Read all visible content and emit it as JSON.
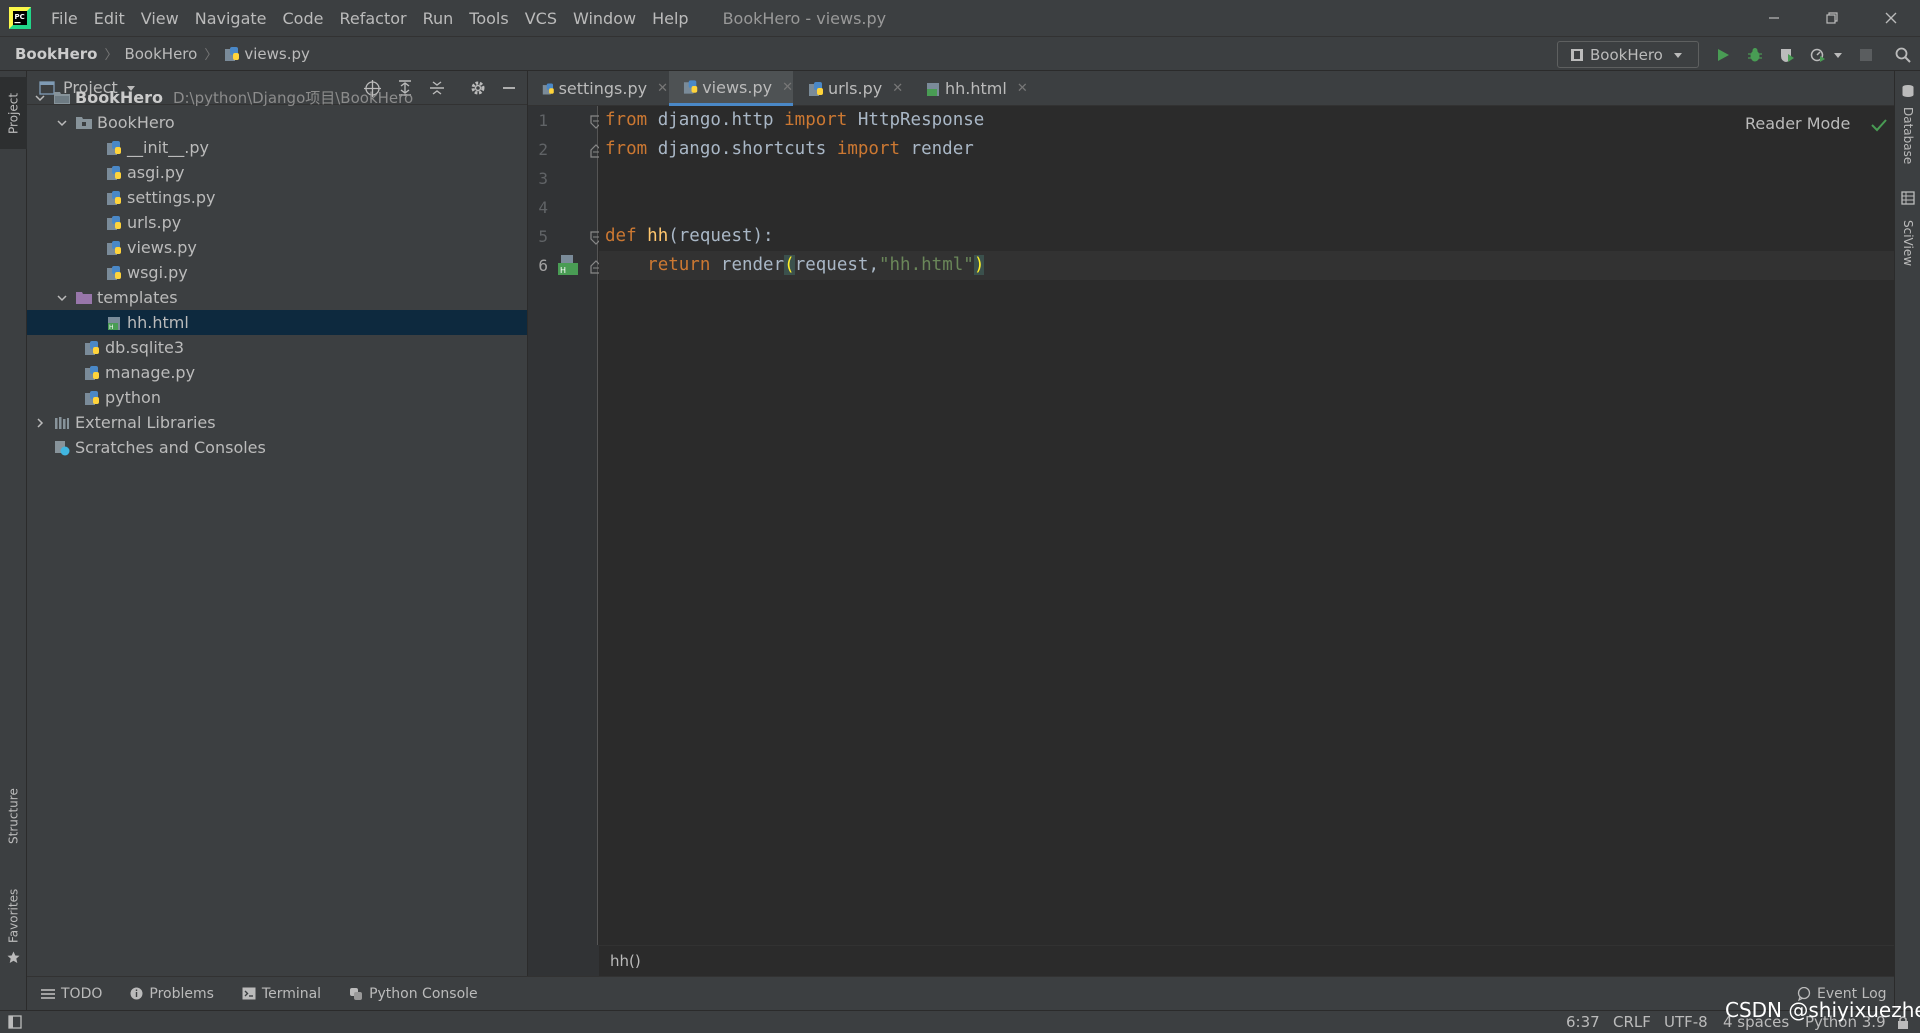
{
  "menubar": {
    "items": [
      "File",
      "Edit",
      "View",
      "Navigate",
      "Code",
      "Refactor",
      "Run",
      "Tools",
      "VCS",
      "Window",
      "Help"
    ],
    "window_title": "BookHero - views.py"
  },
  "navbar": {
    "crumbs": [
      "BookHero",
      "BookHero",
      "views.py"
    ],
    "run_config": "BookHero"
  },
  "project_panel": {
    "title": "Project",
    "tree": [
      {
        "label": "BookHero",
        "path": "D:\\python\\Django项目\\BookHero"
      },
      {
        "label": "BookHero"
      },
      {
        "label": "__init__.py"
      },
      {
        "label": "asgi.py"
      },
      {
        "label": "settings.py"
      },
      {
        "label": "urls.py"
      },
      {
        "label": "views.py"
      },
      {
        "label": "wsgi.py"
      },
      {
        "label": "templates"
      },
      {
        "label": "hh.html"
      },
      {
        "label": "db.sqlite3"
      },
      {
        "label": "manage.py"
      },
      {
        "label": "python"
      },
      {
        "label": "External Libraries"
      },
      {
        "label": "Scratches and Consoles"
      }
    ]
  },
  "editor": {
    "tabs": [
      "settings.py",
      "views.py",
      "urls.py",
      "hh.html"
    ],
    "active_tab": "views.py",
    "reader_mode": "Reader Mode",
    "line_numbers": [
      "1",
      "2",
      "3",
      "4",
      "5",
      "6"
    ],
    "code": {
      "l1": {
        "kw1": "from",
        "t1": " django.http ",
        "kw2": "import",
        "t2": " HttpResponse"
      },
      "l2": {
        "kw1": "from",
        "t1": " django.shortcuts ",
        "kw2": "import",
        "t2": " render"
      },
      "l5": {
        "kw1": "def",
        "t1": " ",
        "fn": "hh",
        "t2": "(request):"
      },
      "l6": {
        "indent": "    ",
        "kw1": "return",
        "t1": " render",
        "open": "(",
        "t2": "request,",
        "str": "\"hh.html\"",
        "close": ")"
      }
    },
    "breadcrumb": "hh()"
  },
  "left_strip": {
    "project": "Project",
    "structure": "Structure",
    "favorites": "Favorites"
  },
  "right_strip": {
    "database": "Database",
    "sciview": "SciView"
  },
  "bottom_tools": [
    "TODO",
    "Problems",
    "Terminal",
    "Python Console"
  ],
  "event_log": "Event Log",
  "status": {
    "position": "6:37",
    "line_sep": "CRLF",
    "encoding": "UTF-8",
    "indent": "4 spaces",
    "interpreter": "Python 3.9"
  },
  "watermark": "CSDN @shiyixuezhe",
  "colors": {
    "keyword": "#cc7832",
    "function": "#ffc66d",
    "string": "#6a8759",
    "selection": "#0d293e",
    "accent": "#4a88c7"
  }
}
